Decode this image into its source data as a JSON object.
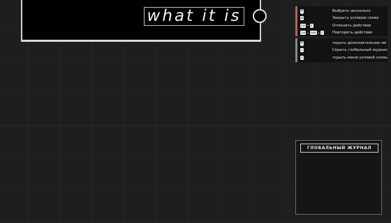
{
  "node": {
    "title": "what it is"
  },
  "hints_upper": [
    {
      "keys": [
        "mouse-left"
      ],
      "label": "Выбрать несколько"
    },
    {
      "keys": [
        "W"
      ],
      "label": "Закрыть узловую схему"
    },
    {
      "keys": [
        "Ctrl",
        "Z"
      ],
      "label": "Отменить действие"
    },
    {
      "keys": [
        "Ctrl",
        "Shift",
        "Z"
      ],
      "label": "Повторить действие"
    }
  ],
  "hints_lower": [
    {
      "keys": [
        "mouse-left"
      ],
      "label": "ткрыть дополнительное ме"
    },
    {
      "keys": [
        "L"
      ],
      "label": "Скрыть глобальный журнал"
    },
    {
      "keys": [
        "H"
      ],
      "label": "ткрыть меню узловой схемь"
    }
  ],
  "journal": {
    "title": "ГЛОБАЛЬНЫЙ ЖУРНАЛ"
  },
  "icons": {
    "mouse": "mouse-icon",
    "connector": "circle-connector-icon"
  },
  "colors": {
    "background": "#1d1e1f",
    "accent_upper": "#b46752",
    "accent_lower": "#8a8a8a"
  }
}
